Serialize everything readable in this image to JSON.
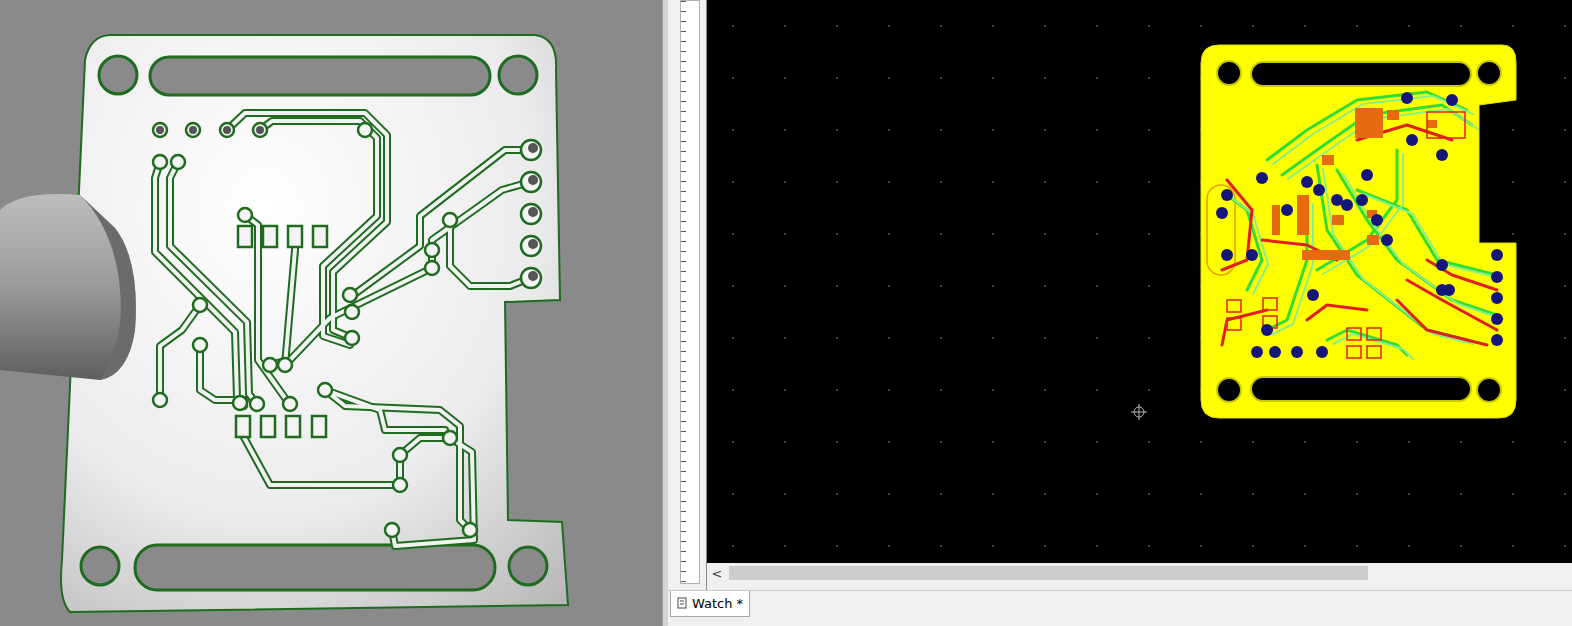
{
  "tabs": [
    {
      "label": "Watch *",
      "selected": true
    }
  ],
  "horizontal_scrollbar": {
    "arrow": "<",
    "level": 0.76
  }
}
